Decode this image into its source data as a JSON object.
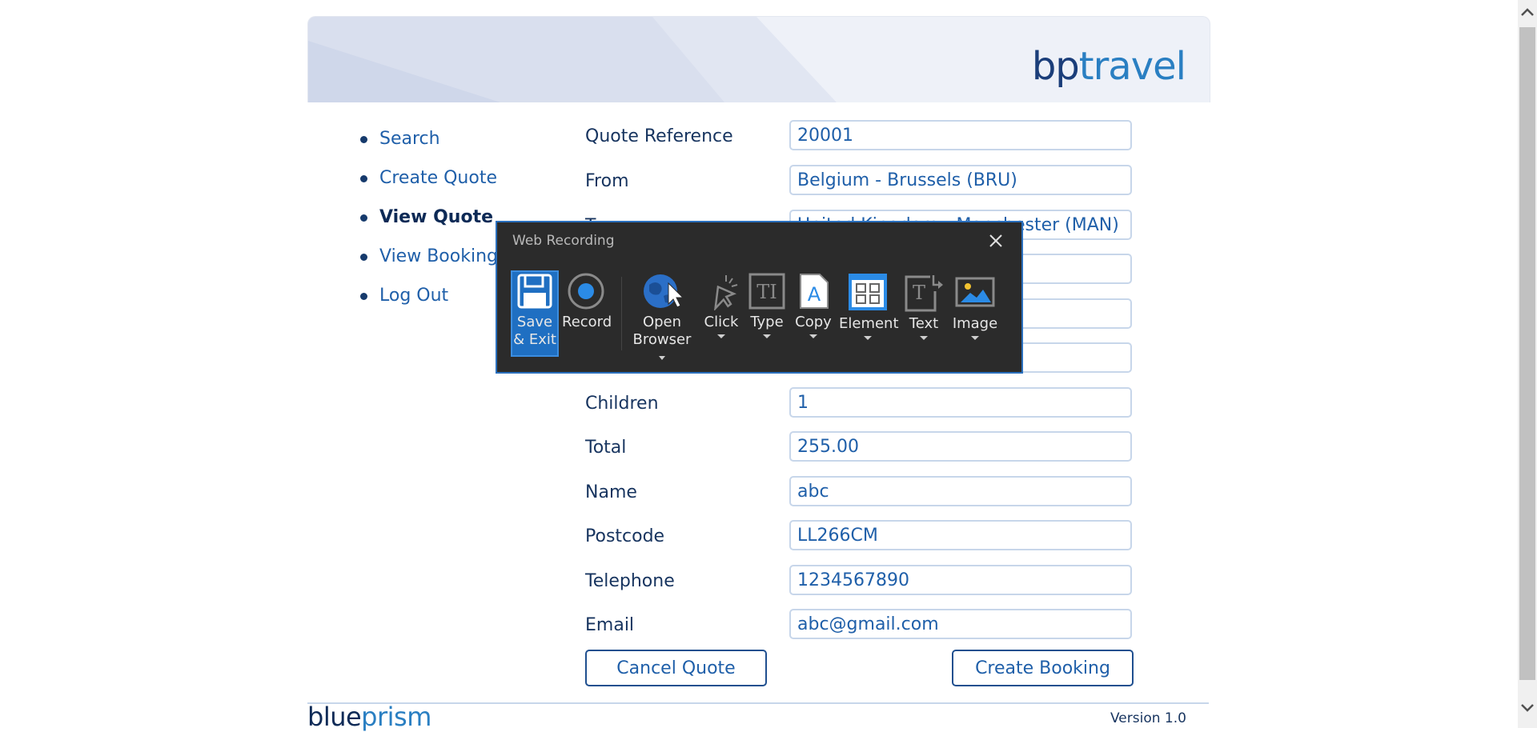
{
  "brand": {
    "part1": "bp",
    "part2": "travel"
  },
  "nav": {
    "items": [
      {
        "label": "Search"
      },
      {
        "label": "Create Quote"
      },
      {
        "label": "View Quote"
      },
      {
        "label": "View Booking"
      },
      {
        "label": "Log Out"
      }
    ],
    "active": "View Quote"
  },
  "form": {
    "fields": [
      {
        "label": "Quote Reference",
        "value": "20001"
      },
      {
        "label": "From",
        "value": "Belgium - Brussels (BRU)"
      },
      {
        "label": "To",
        "value": "United Kingdom - Manchester (MAN)"
      },
      {
        "label": "",
        "value": ""
      },
      {
        "label": "",
        "value": ""
      },
      {
        "label": "",
        "value": ""
      },
      {
        "label": "Children",
        "value": "1"
      },
      {
        "label": "Total",
        "value": "255.00"
      },
      {
        "label": "Name",
        "value": "abc"
      },
      {
        "label": "Postcode",
        "value": "LL266CM"
      },
      {
        "label": "Telephone",
        "value": "1234567890"
      },
      {
        "label": "Email",
        "value": "abc@gmail.com"
      }
    ],
    "cancel_label": "Cancel Quote",
    "create_label": "Create Booking"
  },
  "footer": {
    "brand1": "blue",
    "brand2": "prism",
    "version": "Version 1.0"
  },
  "recorder": {
    "title": "Web Recording",
    "tools": [
      {
        "line1": "Save",
        "line2": "& Exit",
        "icon": "floppy-disk-icon"
      },
      {
        "line1": "Record",
        "line2": "",
        "icon": "record-icon"
      },
      {
        "line1": "Open",
        "line2": "Browser",
        "icon": "globe-cursor-icon"
      },
      {
        "line1": "Click",
        "line2": "",
        "icon": "click-icon"
      },
      {
        "line1": "Type",
        "line2": "",
        "icon": "type-icon"
      },
      {
        "line1": "Copy",
        "line2": "",
        "icon": "copy-document-icon"
      },
      {
        "line1": "Element",
        "line2": "",
        "icon": "element-grid-icon"
      },
      {
        "line1": "Text",
        "line2": "",
        "icon": "text-icon"
      },
      {
        "line1": "Image",
        "line2": "",
        "icon": "image-icon"
      }
    ]
  },
  "colors": {
    "accent": "#1f5fa9",
    "nav_active": "#0d2a56",
    "recorder_bg": "#2b2b2b",
    "recorder_selected": "#1f6fc2"
  }
}
